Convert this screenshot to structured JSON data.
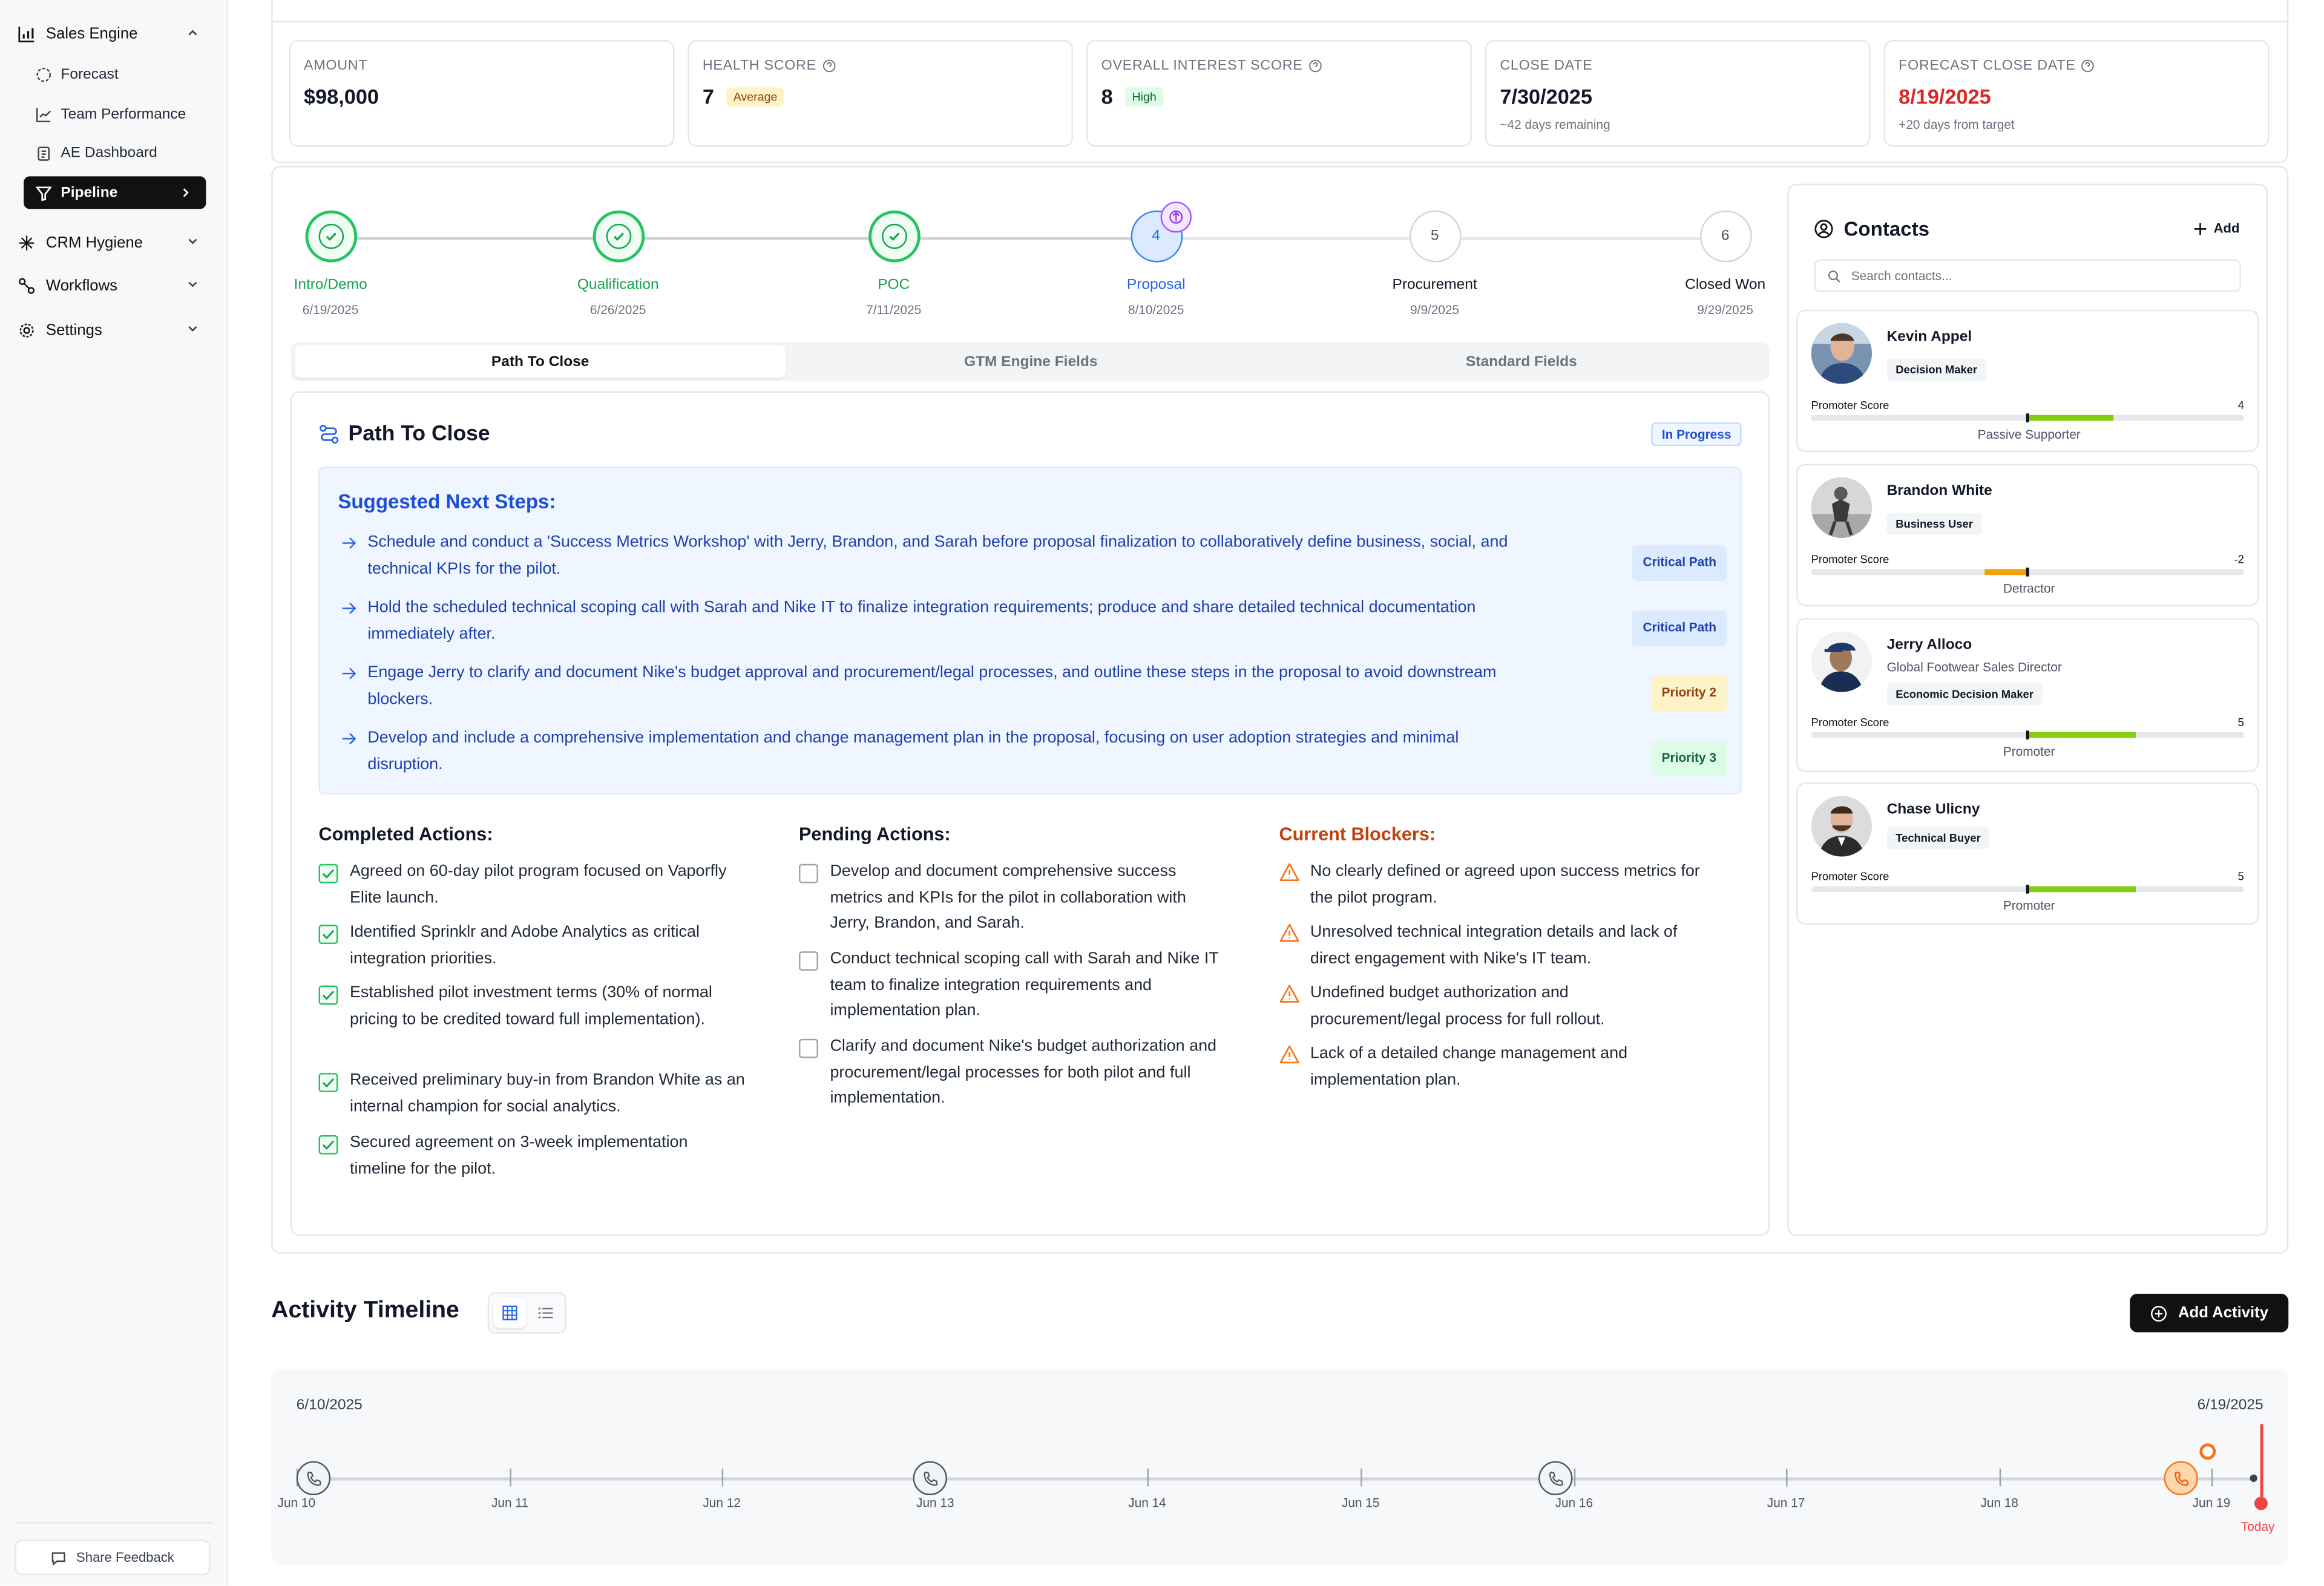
{
  "sidebar": {
    "sales_engine": "Sales Engine",
    "forecast": "Forecast",
    "team_performance": "Team Performance",
    "ae_dashboard": "AE Dashboard",
    "pipeline": "Pipeline",
    "crm_hygiene": "CRM Hygiene",
    "workflows": "Workflows",
    "settings": "Settings",
    "share_feedback": "Share Feedback"
  },
  "metrics": {
    "amount": {
      "label": "AMOUNT",
      "value": "$98,000"
    },
    "health": {
      "label": "HEALTH SCORE",
      "value": "7",
      "badge": "Average"
    },
    "interest": {
      "label": "OVERALL INTEREST SCORE",
      "value": "8",
      "badge": "High"
    },
    "close": {
      "label": "CLOSE DATE",
      "value": "7/30/2025",
      "sub": "~42 days remaining"
    },
    "forecast": {
      "label": "FORECAST CLOSE DATE",
      "value": "8/19/2025",
      "sub": "+20 days from target"
    }
  },
  "stages": [
    {
      "name": "Intro/Demo",
      "date": "6/19/2025",
      "status": "done"
    },
    {
      "name": "Qualification",
      "date": "6/26/2025",
      "status": "done"
    },
    {
      "name": "POC",
      "date": "7/11/2025",
      "status": "done"
    },
    {
      "name": "Proposal",
      "date": "8/10/2025",
      "status": "current",
      "num": "4"
    },
    {
      "name": "Procurement",
      "date": "9/9/2025",
      "status": "todo",
      "num": "5"
    },
    {
      "name": "Closed Won",
      "date": "9/29/2025",
      "status": "todo",
      "num": "6"
    }
  ],
  "tabs": [
    "Path To Close",
    "GTM Engine Fields",
    "Standard Fields"
  ],
  "path_to_close": {
    "title": "Path To Close",
    "status": "In Progress",
    "suggested_title": "Suggested Next Steps:",
    "steps": [
      {
        "line1": "Schedule and conduct a 'Success Metrics Workshop' with Jerry, Brandon, and Sarah before proposal finalization to collaboratively define business, social, and",
        "line2": "technical KPIs for the pilot.",
        "tag": "Critical Path"
      },
      {
        "line1": "Hold the scheduled technical scoping call with Sarah and Nike IT to finalize integration requirements; produce and share detailed technical documentation",
        "line2": "immediately after.",
        "tag": "Critical Path"
      },
      {
        "line1": "Engage Jerry to clarify and document Nike's budget approval and procurement/legal processes, and outline these steps in the proposal to avoid downstream",
        "line2": "blockers.",
        "tag": "Priority 2"
      },
      {
        "line1": "Develop and include a comprehensive implementation and change management plan in the proposal, focusing on user adoption strategies and minimal",
        "line2": "disruption.",
        "tag": "Priority 3"
      }
    ],
    "completed_title": "Completed Actions:",
    "completed": [
      [
        "Agreed on 60-day pilot program focused on Vaporfly",
        "Elite launch."
      ],
      [
        "Identified Sprinklr and Adobe Analytics as critical",
        "integration priorities."
      ],
      [
        "Established pilot investment terms (30% of normal",
        "pricing to be credited toward full implementation)."
      ],
      [
        "Received preliminary buy-in from Brandon White as an",
        "internal champion for social analytics."
      ],
      [
        "Secured agreement on 3-week implementation",
        "timeline for the pilot."
      ]
    ],
    "pending_title": "Pending Actions:",
    "pending": [
      [
        "Develop and document comprehensive success",
        "metrics and KPIs for the pilot in collaboration with",
        "Jerry, Brandon, and Sarah."
      ],
      [
        "Conduct technical scoping call with Sarah and Nike IT",
        "team to finalize integration requirements and",
        "implementation plan."
      ],
      [
        "Clarify and document Nike's budget authorization and",
        "procurement/legal processes for both pilot and full",
        "implementation."
      ]
    ],
    "blockers_title": "Current Blockers:",
    "blockers": [
      [
        "No clearly defined or agreed upon success metrics for",
        "the pilot program."
      ],
      [
        "Unresolved technical integration details and lack of",
        "direct engagement with Nike's IT team."
      ],
      [
        "Undefined budget authorization and",
        "procurement/legal process for full rollout."
      ],
      [
        "Lack of a detailed change management and",
        "implementation plan."
      ]
    ]
  },
  "contacts": {
    "title": "Contacts",
    "add_label": "Add",
    "search_placeholder": "Search contacts...",
    "score_label": "Promoter Score",
    "people": [
      {
        "name": "Kevin Appel",
        "title": "",
        "role": "Decision Maker",
        "score": 4,
        "score_text": "4",
        "status": "Passive Supporter"
      },
      {
        "name": "Brandon White",
        "title": "",
        "role": "Business User",
        "score": -2,
        "score_text": "-2",
        "status": "Detractor"
      },
      {
        "name": "Jerry Alloco",
        "title": "Global Footwear Sales Director",
        "role": "Economic Decision Maker",
        "score": 5,
        "score_text": "5",
        "status": "Promoter"
      },
      {
        "name": "Chase Ulicny",
        "title": "",
        "role": "Technical Buyer",
        "score": 5,
        "score_text": "5",
        "status": "Promoter"
      }
    ]
  },
  "activity": {
    "title": "Activity Timeline",
    "add_label": "Add Activity",
    "start_date": "6/10/2025",
    "end_date": "6/19/2025",
    "ticks": [
      "Jun 10",
      "Jun 11",
      "Jun 12",
      "Jun 13",
      "Jun 14",
      "Jun 15",
      "Jun 16",
      "Jun 17",
      "Jun 18",
      "Jun 19"
    ],
    "today_label": "Today"
  },
  "colors": {
    "done": "#22c55e",
    "current": "#3b82f6",
    "warning": "#f97316",
    "danger": "#dc2626",
    "accent_blue": "#1d4ed8"
  }
}
